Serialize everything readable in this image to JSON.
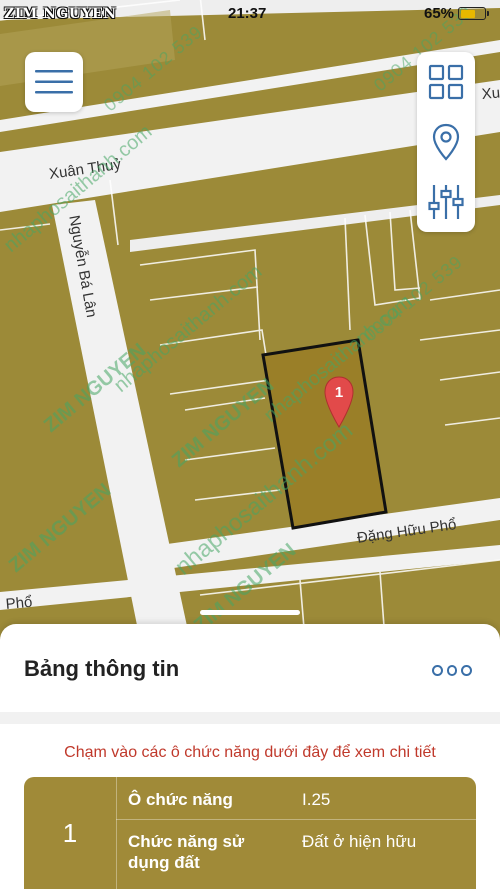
{
  "status_bar": {
    "carrier": "ZIM NGUYEN",
    "time": "21:37",
    "battery": "65%",
    "battery_level": 0.65
  },
  "map": {
    "street_labels": [
      "Xuân Thuỷ",
      "Nguyễn Bá Lân",
      "Đặng Hữu Phổ",
      "Phổ",
      "Xu"
    ],
    "marker_label": "1",
    "watermarks": {
      "brand": "ZIM NGUYEN",
      "site": "nhaphosaithanh.com",
      "phone": "0904 102 539"
    }
  },
  "icons": {
    "menu": "hamburger-icon",
    "grid": "grid-icon",
    "location": "location-pin-icon",
    "filter": "sliders-icon",
    "more": "more-icon"
  },
  "sheet": {
    "title": "Bảng thông tin",
    "hint": "Chạm vào các ô chức năng dưới đây để xem chi tiết",
    "row_index": "1",
    "rows": [
      {
        "label": "Ô chức năng",
        "value": "I.25"
      },
      {
        "label": "Chức năng sử dụng đất",
        "value": "Đất ở hiện hữu"
      }
    ]
  },
  "colors": {
    "parcel": "#9c8a38",
    "road": "#f3f3f3",
    "accent": "#3a6fa8",
    "hint": "#c0392b",
    "marker": "#e24a4a",
    "table": "#a08a38"
  }
}
